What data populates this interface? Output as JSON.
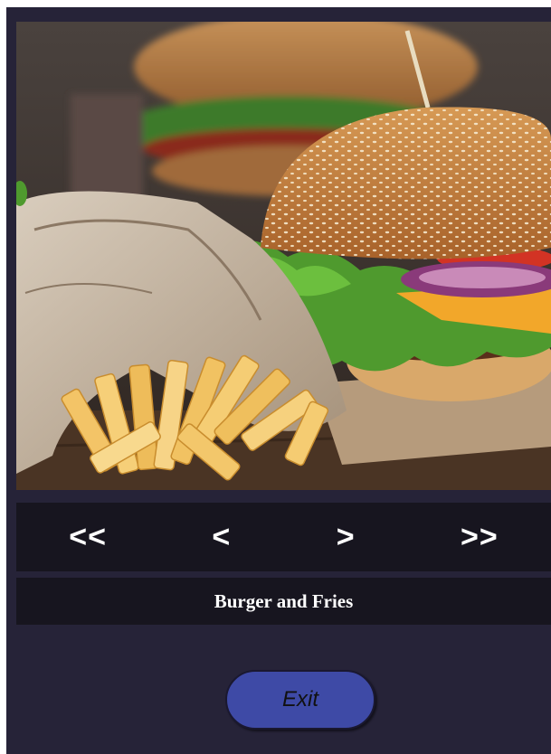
{
  "viewer": {
    "image_alt": "Burger and Fries",
    "nav": {
      "first_label": "<<",
      "prev_label": "<",
      "next_label": ">",
      "last_label": ">>"
    },
    "caption": "Burger and Fries",
    "exit_label": "Exit"
  },
  "colors": {
    "window_bg": "#262338",
    "bar_bg": "#17151f",
    "exit_button": "#3e4aa6",
    "text": "#ffffff"
  }
}
